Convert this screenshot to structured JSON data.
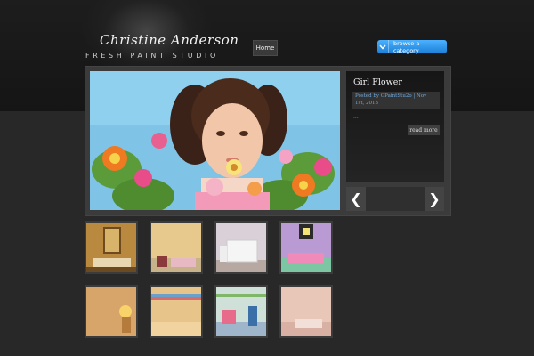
{
  "header": {
    "logo_title": "Christine Anderson",
    "logo_subtitle": "FRESH PAINT STUDIO",
    "nav": {
      "home_label": "Home"
    },
    "browse_label": "browse a category",
    "browse_icon": "chevron-down-icon"
  },
  "featured": {
    "title": "Girl Flower",
    "meta": "Posted by GPaintStu2o | Nov 1st, 2013",
    "excerpt": "...",
    "read_more": "read more",
    "prev_icon": "chevron-left-icon",
    "next_icon": "chevron-right-icon",
    "prev_glyph": "❮",
    "next_glyph": "❯"
  },
  "colors": {
    "accent": "#2b8fe6",
    "meta_text": "#6fa8dc"
  }
}
